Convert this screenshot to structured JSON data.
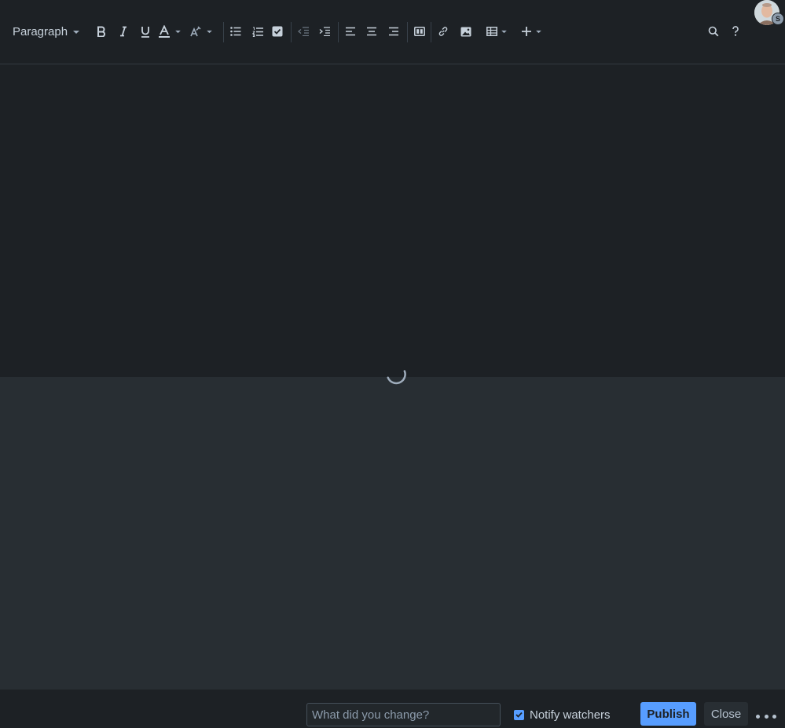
{
  "toolbar": {
    "paragraph_label": "Paragraph",
    "icons": [
      "chevron-down-icon",
      "bold-icon",
      "italic-icon",
      "underline-icon",
      "text-color-icon",
      "text-style-icon",
      "bullet-list-icon",
      "numbered-list-icon",
      "task-list-icon",
      "outdent-icon",
      "indent-icon",
      "align-left-icon",
      "align-center-icon",
      "align-right-icon",
      "layout-icon",
      "link-icon",
      "image-icon",
      "table-icon",
      "plus-icon",
      "search-icon",
      "help-icon"
    ]
  },
  "avatar": {
    "badge": "S"
  },
  "footer": {
    "change_placeholder": "What did you change?",
    "notify_label": "Notify watchers",
    "notify_checked": true,
    "publish_label": "Publish",
    "close_label": "Close"
  },
  "colors": {
    "background": "#1d2125",
    "editor_lower": "#282e33",
    "accent": "#579dff",
    "text": "#c7d1db"
  }
}
